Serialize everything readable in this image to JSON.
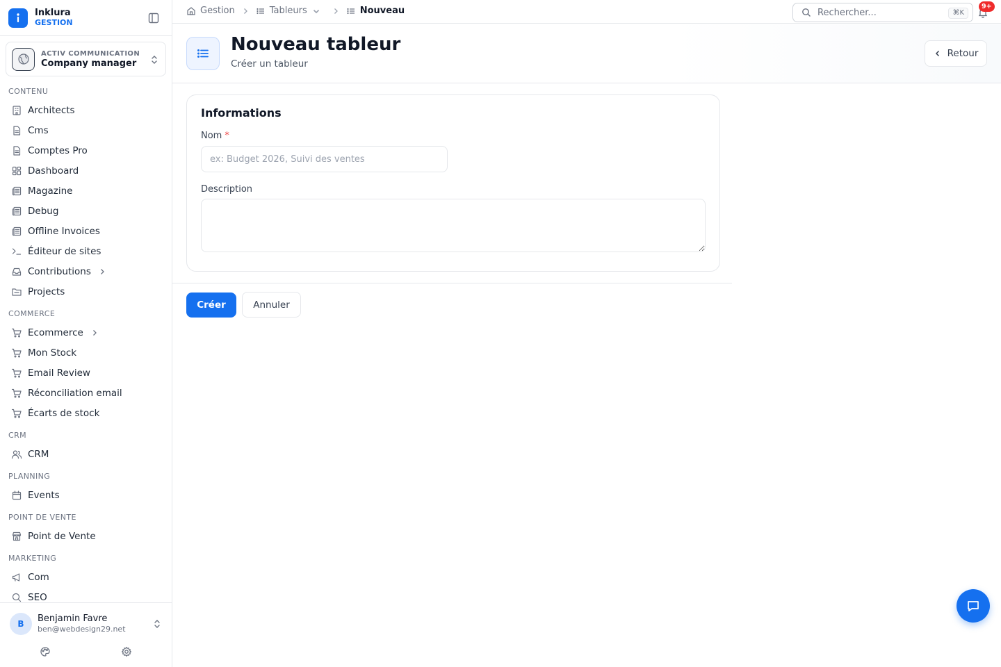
{
  "brand": {
    "name": "Inklura",
    "subtitle": "GESTION",
    "logo_icon": "info-icon"
  },
  "organization": {
    "kicker": "ACTIV COMMUNICATION",
    "name": "Company manager"
  },
  "sidebar": {
    "sections": [
      {
        "title": "CONTENU",
        "items": [
          {
            "label": "Architects",
            "icon": "building-icon"
          },
          {
            "label": "Cms",
            "icon": "file-icon"
          },
          {
            "label": "Comptes Pro",
            "icon": "file-icon"
          },
          {
            "label": "Dashboard",
            "icon": "grid-icon"
          },
          {
            "label": "Magazine",
            "icon": "newspaper-icon"
          },
          {
            "label": "Debug",
            "icon": "newspaper-icon"
          },
          {
            "label": "Offline Invoices",
            "icon": "newspaper-icon"
          },
          {
            "label": "Éditeur de sites",
            "icon": "terminal-icon"
          },
          {
            "label": "Contributions",
            "icon": "inbox-icon",
            "has_children": true
          },
          {
            "label": "Projects",
            "icon": "folder-icon"
          }
        ]
      },
      {
        "title": "COMMERCE",
        "items": [
          {
            "label": "Ecommerce",
            "icon": "cart-icon",
            "has_children": true
          },
          {
            "label": "Mon Stock",
            "icon": "cart-icon"
          },
          {
            "label": "Email Review",
            "icon": "cart-icon"
          },
          {
            "label": "Réconciliation email",
            "icon": "cart-icon"
          },
          {
            "label": "Écarts de stock",
            "icon": "cart-icon"
          }
        ]
      },
      {
        "title": "CRM",
        "items": [
          {
            "label": "CRM",
            "icon": "users-icon"
          }
        ]
      },
      {
        "title": "PLANNING",
        "items": [
          {
            "label": "Events",
            "icon": "calendar-icon"
          }
        ]
      },
      {
        "title": "POINT DE VENTE",
        "items": [
          {
            "label": "Point de Vente",
            "icon": "store-icon"
          }
        ]
      },
      {
        "title": "MARKETING",
        "items": [
          {
            "label": "Com",
            "icon": "megaphone-icon"
          },
          {
            "label": "SEO",
            "icon": "search-icon"
          }
        ]
      }
    ]
  },
  "user": {
    "initial": "B",
    "name": "Benjamin Favre",
    "email": "ben@webdesign29.net"
  },
  "breadcrumb": {
    "root": "Gestion",
    "parent": "Tableurs",
    "current": "Nouveau"
  },
  "search": {
    "placeholder": "Rechercher...",
    "shortcut": "⌘K"
  },
  "notifications": {
    "badge": "9+"
  },
  "page": {
    "title": "Nouveau tableur",
    "subtitle": "Créer un tableur",
    "back_label": "Retour"
  },
  "form": {
    "section_title": "Informations",
    "name_label": "Nom",
    "name_required": "*",
    "name_placeholder": "ex: Budget 2026, Suivi des ventes",
    "name_value": "",
    "description_label": "Description",
    "description_value": ""
  },
  "actions": {
    "create_label": "Créer",
    "cancel_label": "Annuler"
  },
  "colors": {
    "accent": "#1570ef",
    "badge": "#ef2b2b",
    "border": "#e5e7eb"
  }
}
